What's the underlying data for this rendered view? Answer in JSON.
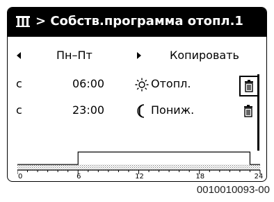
{
  "title": {
    "icon": "list-menu-icon",
    "text": "> Собств.программа отопл.1"
  },
  "header_row": {
    "left_arrow_icon": "arrow-left-icon",
    "day": "Пн–Пт",
    "right_arrow_icon": "arrow-right-icon",
    "copy_label": "Копировать"
  },
  "entries": [
    {
      "prefix": "с",
      "time": "06:00",
      "mode_icon": "sun-icon",
      "mode": "Отопл.",
      "delete_icon": "trash-icon",
      "selected": true
    },
    {
      "prefix": "с",
      "time": "23:00",
      "mode_icon": "moon-icon",
      "mode": "Пониж.",
      "delete_icon": "trash-icon",
      "selected": false
    }
  ],
  "timeline": {
    "tick_labels": [
      "0",
      "6",
      "12",
      "18",
      "24"
    ],
    "heating_from": 6,
    "heating_to": 23,
    "range": [
      0,
      24
    ]
  },
  "footer_code": "0010010093-00"
}
